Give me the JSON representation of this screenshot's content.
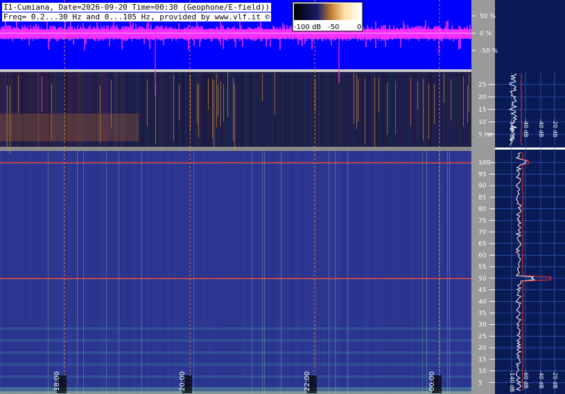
{
  "header": {
    "line1": "I1-Cumiana, Date=2026-09-20 Time=00:30 (Geophone/E-field))",
    "line2": "Freq= 0.2...30 Hz and 0...105 Hz, provided by www.vlf.it ©"
  },
  "colorbar": {
    "labels": [
      "-100 dB",
      "-50",
      "0"
    ]
  },
  "colors": {
    "waveform": "#ff30ff",
    "wave_bg": "#0000ff",
    "spec_bg": "#27318a",
    "axis_bg": "#9a9a9a",
    "profile_bg": "#0a1a55",
    "grid": "#ff8c3a",
    "mark_line": "#ff2020"
  },
  "chart_data": [
    {
      "type": "waveform",
      "yaxis_ticks": [
        "50 %",
        "0 %",
        "-50 %"
      ],
      "y_values": [
        50,
        0,
        -50
      ]
    },
    {
      "type": "heatmap",
      "name_hint": "ELF spectrogram 0.2-30 Hz",
      "yaxis_ticks": [
        "25",
        "20",
        "15",
        "10",
        "5 Hz"
      ],
      "y_values": [
        25,
        20,
        15,
        10,
        5
      ],
      "ylim": [
        0,
        30
      ],
      "profile_db_ticks": [
        "-140 dB",
        "-40 dB",
        "-40 dB",
        "-20 dB"
      ]
    },
    {
      "type": "heatmap",
      "name_hint": "ELF spectrogram 0-105 Hz",
      "yaxis_ticks": [
        "100",
        "95",
        "90",
        "85",
        "80",
        "75",
        "70",
        "65",
        "60",
        "55",
        "50",
        "45",
        "40",
        "35",
        "30",
        "25",
        "20",
        "15",
        "10",
        "5"
      ],
      "y_values": [
        100,
        95,
        90,
        85,
        80,
        75,
        70,
        65,
        60,
        55,
        50,
        45,
        40,
        35,
        30,
        25,
        20,
        15,
        10,
        5
      ],
      "ylim": [
        0,
        105
      ],
      "marked_lines_hz": [
        100,
        50
      ],
      "time_labels": [
        "18:00",
        "20:00",
        "22:00",
        "00:00"
      ],
      "profile_db_ticks": [
        "-140 dB",
        "-60 dB",
        "-40 dB",
        "-20 dB"
      ]
    }
  ]
}
